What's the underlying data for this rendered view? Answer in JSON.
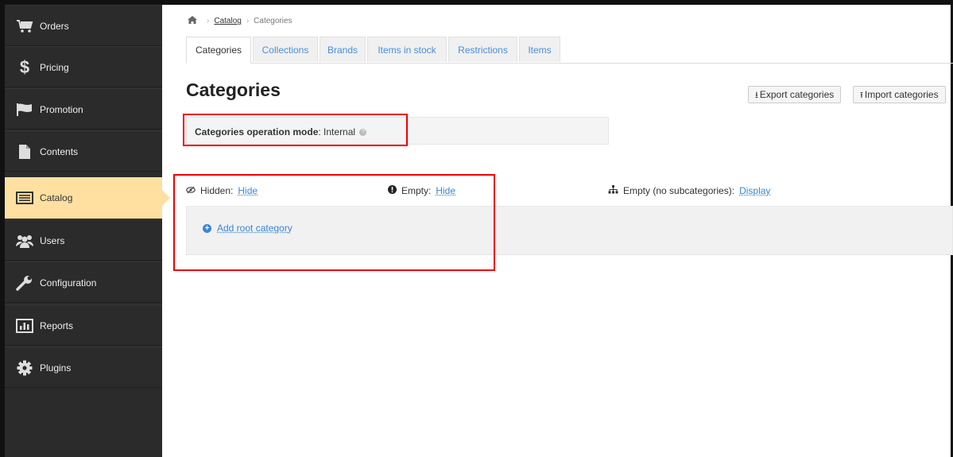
{
  "sidebar": {
    "items": [
      {
        "label": "Orders",
        "icon": "cart-icon"
      },
      {
        "label": "Pricing",
        "icon": "dollar-icon"
      },
      {
        "label": "Promotion",
        "icon": "flag-icon"
      },
      {
        "label": "Contents",
        "icon": "file-icon"
      },
      {
        "label": "Catalog",
        "icon": "list-icon",
        "active": true
      },
      {
        "label": "Users",
        "icon": "users-icon"
      },
      {
        "label": "Configuration",
        "icon": "wrench-icon"
      },
      {
        "label": "Reports",
        "icon": "bar-chart-icon"
      },
      {
        "label": "Plugins",
        "icon": "gear-icon"
      }
    ]
  },
  "breadcrumb": {
    "home_icon": "home-icon",
    "catalog": "Catalog",
    "current": "Categories"
  },
  "tabs": [
    {
      "label": "Categories",
      "active": true
    },
    {
      "label": "Collections"
    },
    {
      "label": "Brands"
    },
    {
      "label": "Items in stock"
    },
    {
      "label": "Restrictions"
    },
    {
      "label": "Items"
    }
  ],
  "page": {
    "title": "Categories",
    "export_label": "Export categories",
    "import_label": "Import categories"
  },
  "mode": {
    "label": "Categories operation mode",
    "value": "Internal"
  },
  "filters": {
    "hidden_label": "Hidden:",
    "hidden_action": "Hide",
    "empty_label": "Empty:",
    "empty_action": "Hide",
    "nosub_label": "Empty (no subcategories):",
    "nosub_action": "Display"
  },
  "categories": {
    "add_root_label": "Add root category"
  },
  "colors": {
    "sidebar_bg": "#2b2b2b",
    "active_item": "#ffe0a1",
    "link": "#3b86d0",
    "highlight": "#e00000"
  }
}
